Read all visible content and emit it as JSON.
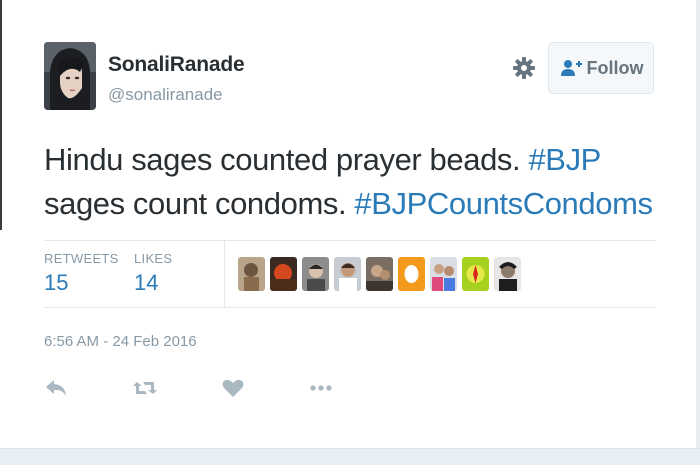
{
  "tweet": {
    "author": {
      "name": "SonaliRanade",
      "handle": "@sonaliranade",
      "avatar_icon": "profile-photo"
    },
    "follow_label": "Follow",
    "text": {
      "line1_plain": "Hindu sages counted prayer beads. ",
      "line1_hashtag": "#BJP",
      "line2_plain": "sages count condoms. ",
      "line2_hashtag": "#BJPCountsCondoms"
    },
    "stats": {
      "retweets_label": "RETWEETS",
      "retweets_value": "15",
      "likes_label": "LIKES",
      "likes_value": "14"
    },
    "likers_count_shown": 9,
    "timestamp": "6:56 AM - 24 Feb 2016",
    "actions": [
      "reply-icon",
      "retweet-icon",
      "like-icon",
      "more-icon"
    ]
  },
  "colors": {
    "text": "#292f33",
    "muted": "#8899a6",
    "link": "#2b7bb9",
    "border": "#e1e8ed",
    "icon": "#aab8c2"
  }
}
